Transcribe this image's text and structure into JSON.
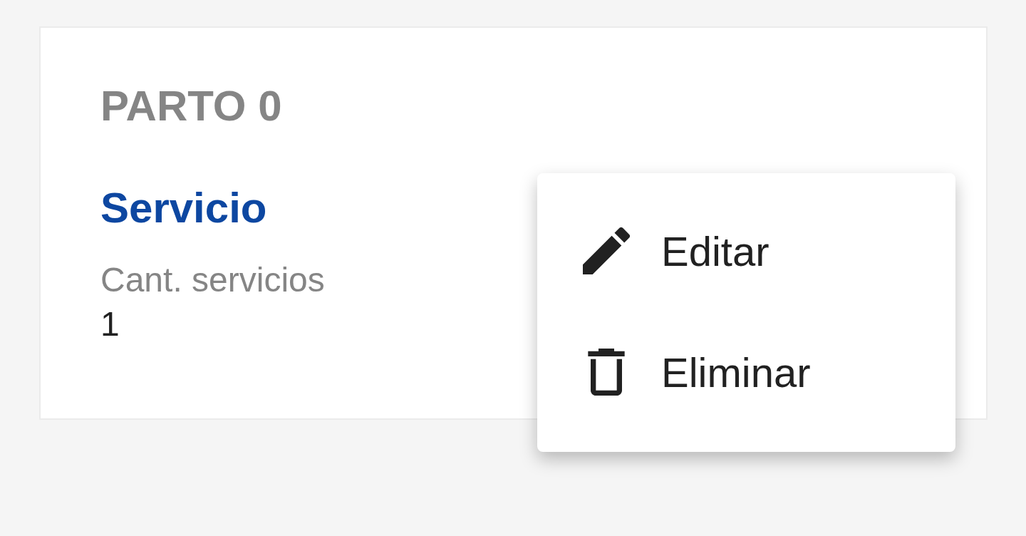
{
  "card": {
    "title": "PARTO 0",
    "subtitle": "Servicio",
    "field": {
      "label": "Cant. servicios",
      "value": "1"
    }
  },
  "menu": {
    "items": [
      {
        "kind": "edit",
        "label": "Editar"
      },
      {
        "kind": "delete",
        "label": "Eliminar"
      }
    ]
  }
}
